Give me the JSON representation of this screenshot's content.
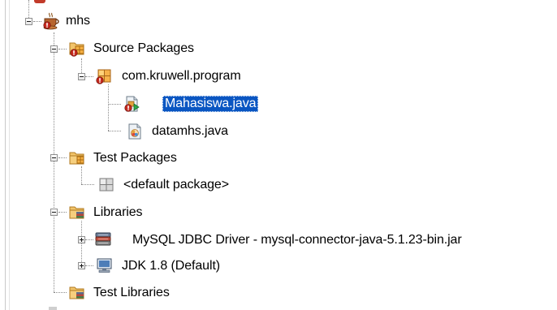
{
  "tree": {
    "project": {
      "label": "mhs",
      "icon": "coffee-cup-icon"
    },
    "source_packages": {
      "label": "Source Packages",
      "icon": "source-packages-icon"
    },
    "package": {
      "label": "com.kruwell.program",
      "icon": "package-icon"
    },
    "file_main": {
      "label": "Mahasiswa.java",
      "icon": "java-main-class-icon",
      "selected": true
    },
    "file_data": {
      "label": "datamhs.java",
      "icon": "java-class-icon"
    },
    "test_packages": {
      "label": "Test Packages",
      "icon": "test-packages-icon"
    },
    "default_package": {
      "label": "<default package>",
      "icon": "empty-package-icon"
    },
    "libraries": {
      "label": "Libraries",
      "icon": "libraries-folder-icon"
    },
    "lib_mysql": {
      "label": "MySQL JDBC Driver - mysql-connector-java-5.1.23-bin.jar",
      "icon": "jar-library-icon"
    },
    "lib_jdk": {
      "label": "JDK 1.8 (Default)",
      "icon": "jdk-platform-icon"
    },
    "test_libraries": {
      "label": "Test Libraries",
      "icon": "test-libraries-folder-icon"
    }
  },
  "colors": {
    "selection": "#0a56c2",
    "error_badge": "#c62a1f",
    "package_orange": "#e8a33a"
  }
}
